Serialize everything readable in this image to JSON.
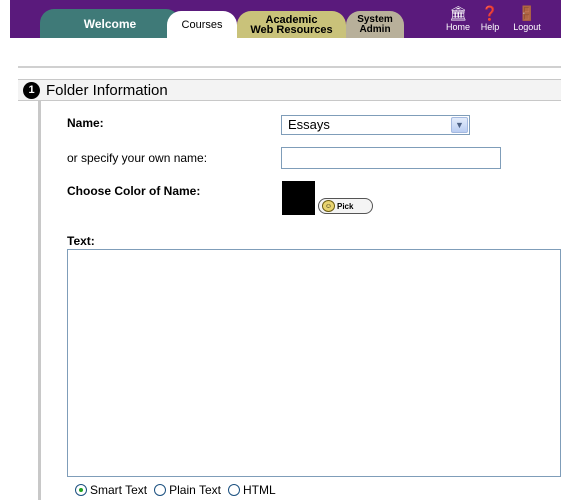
{
  "nav": {
    "tabs": {
      "welcome": "Welcome",
      "courses": "Courses",
      "academic_line1": "Academic",
      "academic_line2": "Web Resources",
      "admin_line1": "System",
      "admin_line2": "Admin"
    },
    "icons": [
      {
        "name": "home-icon",
        "label": "Home",
        "glyph": "🏛"
      },
      {
        "name": "help-icon",
        "label": "Help",
        "glyph": "❓"
      },
      {
        "name": "logout-icon",
        "label": "Logout",
        "glyph": "🚪"
      }
    ],
    "bar_color": "#5a1a7c"
  },
  "section": {
    "number": "1",
    "title": "Folder Information"
  },
  "form": {
    "name_label": "Name:",
    "name_selected": "Essays",
    "own_name_label": "or specify your own name:",
    "own_name_value": "",
    "color_label": "Choose Color of Name:",
    "color_value": "#000000",
    "pick_label": "Pick",
    "text_label": "Text:",
    "text_value": "",
    "format_options": [
      {
        "label": "Smart Text",
        "checked": true
      },
      {
        "label": "Plain Text",
        "checked": false
      },
      {
        "label": "HTML",
        "checked": false
      }
    ]
  }
}
